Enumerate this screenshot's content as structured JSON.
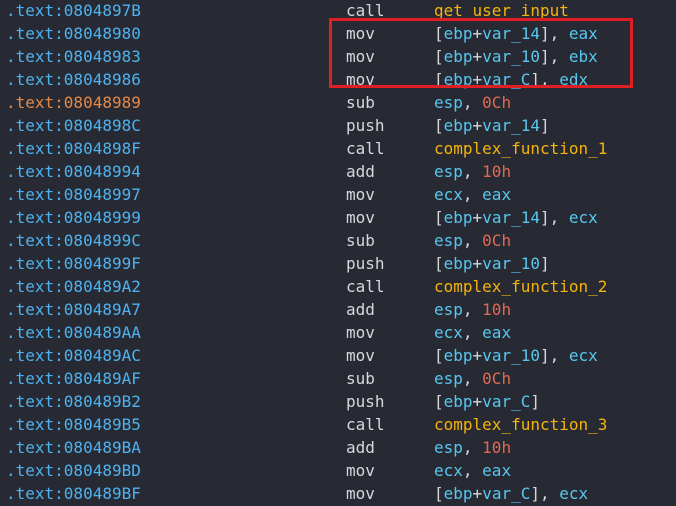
{
  "rows": [
    {
      "addr": ".text:0804897B",
      "mnemonic": "call",
      "tokens": [
        {
          "t": "fn",
          "v": "get_user_input"
        }
      ]
    },
    {
      "addr": ".text:08048980",
      "mnemonic": "mov",
      "tokens": [
        {
          "t": "punc",
          "v": "["
        },
        {
          "t": "reg",
          "v": "ebp"
        },
        {
          "t": "punc",
          "v": "+"
        },
        {
          "t": "reg",
          "v": "var_14"
        },
        {
          "t": "punc",
          "v": "], "
        },
        {
          "t": "reg",
          "v": "eax"
        }
      ]
    },
    {
      "addr": ".text:08048983",
      "mnemonic": "mov",
      "tokens": [
        {
          "t": "punc",
          "v": "["
        },
        {
          "t": "reg",
          "v": "ebp"
        },
        {
          "t": "punc",
          "v": "+"
        },
        {
          "t": "reg",
          "v": "var_10"
        },
        {
          "t": "punc",
          "v": "], "
        },
        {
          "t": "reg",
          "v": "ebx"
        }
      ]
    },
    {
      "addr": ".text:08048986",
      "mnemonic": "mov",
      "tokens": [
        {
          "t": "punc",
          "v": "["
        },
        {
          "t": "reg",
          "v": "ebp"
        },
        {
          "t": "punc",
          "v": "+"
        },
        {
          "t": "reg",
          "v": "var_C"
        },
        {
          "t": "punc",
          "v": "], "
        },
        {
          "t": "reg",
          "v": "edx"
        }
      ]
    },
    {
      "addr": ".text:08048989",
      "mnemonic": "sub",
      "current": true,
      "tokens": [
        {
          "t": "reg",
          "v": "esp"
        },
        {
          "t": "punc",
          "v": ", "
        },
        {
          "t": "num",
          "v": "0Ch"
        }
      ]
    },
    {
      "addr": ".text:0804898C",
      "mnemonic": "push",
      "tokens": [
        {
          "t": "punc",
          "v": "["
        },
        {
          "t": "reg",
          "v": "ebp"
        },
        {
          "t": "punc",
          "v": "+"
        },
        {
          "t": "reg",
          "v": "var_14"
        },
        {
          "t": "punc",
          "v": "]"
        }
      ]
    },
    {
      "addr": ".text:0804898F",
      "mnemonic": "call",
      "tokens": [
        {
          "t": "fn",
          "v": "complex_function_1"
        }
      ]
    },
    {
      "addr": ".text:08048994",
      "mnemonic": "add",
      "tokens": [
        {
          "t": "reg",
          "v": "esp"
        },
        {
          "t": "punc",
          "v": ", "
        },
        {
          "t": "num",
          "v": "10h"
        }
      ]
    },
    {
      "addr": ".text:08048997",
      "mnemonic": "mov",
      "tokens": [
        {
          "t": "reg",
          "v": "ecx"
        },
        {
          "t": "punc",
          "v": ", "
        },
        {
          "t": "reg",
          "v": "eax"
        }
      ]
    },
    {
      "addr": ".text:08048999",
      "mnemonic": "mov",
      "tokens": [
        {
          "t": "punc",
          "v": "["
        },
        {
          "t": "reg",
          "v": "ebp"
        },
        {
          "t": "punc",
          "v": "+"
        },
        {
          "t": "reg",
          "v": "var_14"
        },
        {
          "t": "punc",
          "v": "], "
        },
        {
          "t": "reg",
          "v": "ecx"
        }
      ]
    },
    {
      "addr": ".text:0804899C",
      "mnemonic": "sub",
      "tokens": [
        {
          "t": "reg",
          "v": "esp"
        },
        {
          "t": "punc",
          "v": ", "
        },
        {
          "t": "num",
          "v": "0Ch"
        }
      ]
    },
    {
      "addr": ".text:0804899F",
      "mnemonic": "push",
      "tokens": [
        {
          "t": "punc",
          "v": "["
        },
        {
          "t": "reg",
          "v": "ebp"
        },
        {
          "t": "punc",
          "v": "+"
        },
        {
          "t": "reg",
          "v": "var_10"
        },
        {
          "t": "punc",
          "v": "]"
        }
      ]
    },
    {
      "addr": ".text:080489A2",
      "mnemonic": "call",
      "tokens": [
        {
          "t": "fn",
          "v": "complex_function_2"
        }
      ]
    },
    {
      "addr": ".text:080489A7",
      "mnemonic": "add",
      "tokens": [
        {
          "t": "reg",
          "v": "esp"
        },
        {
          "t": "punc",
          "v": ", "
        },
        {
          "t": "num",
          "v": "10h"
        }
      ]
    },
    {
      "addr": ".text:080489AA",
      "mnemonic": "mov",
      "tokens": [
        {
          "t": "reg",
          "v": "ecx"
        },
        {
          "t": "punc",
          "v": ", "
        },
        {
          "t": "reg",
          "v": "eax"
        }
      ]
    },
    {
      "addr": ".text:080489AC",
      "mnemonic": "mov",
      "tokens": [
        {
          "t": "punc",
          "v": "["
        },
        {
          "t": "reg",
          "v": "ebp"
        },
        {
          "t": "punc",
          "v": "+"
        },
        {
          "t": "reg",
          "v": "var_10"
        },
        {
          "t": "punc",
          "v": "], "
        },
        {
          "t": "reg",
          "v": "ecx"
        }
      ]
    },
    {
      "addr": ".text:080489AF",
      "mnemonic": "sub",
      "tokens": [
        {
          "t": "reg",
          "v": "esp"
        },
        {
          "t": "punc",
          "v": ", "
        },
        {
          "t": "num",
          "v": "0Ch"
        }
      ]
    },
    {
      "addr": ".text:080489B2",
      "mnemonic": "push",
      "tokens": [
        {
          "t": "punc",
          "v": "["
        },
        {
          "t": "reg",
          "v": "ebp"
        },
        {
          "t": "punc",
          "v": "+"
        },
        {
          "t": "reg",
          "v": "var_C"
        },
        {
          "t": "punc",
          "v": "]"
        }
      ]
    },
    {
      "addr": ".text:080489B5",
      "mnemonic": "call",
      "tokens": [
        {
          "t": "fn",
          "v": "complex_function_3"
        }
      ]
    },
    {
      "addr": ".text:080489BA",
      "mnemonic": "add",
      "tokens": [
        {
          "t": "reg",
          "v": "esp"
        },
        {
          "t": "punc",
          "v": ", "
        },
        {
          "t": "num",
          "v": "10h"
        }
      ]
    },
    {
      "addr": ".text:080489BD",
      "mnemonic": "mov",
      "tokens": [
        {
          "t": "reg",
          "v": "ecx"
        },
        {
          "t": "punc",
          "v": ", "
        },
        {
          "t": "reg",
          "v": "eax"
        }
      ]
    },
    {
      "addr": ".text:080489BF",
      "mnemonic": "mov",
      "tokens": [
        {
          "t": "punc",
          "v": "["
        },
        {
          "t": "reg",
          "v": "ebp"
        },
        {
          "t": "punc",
          "v": "+"
        },
        {
          "t": "reg",
          "v": "var_C"
        },
        {
          "t": "punc",
          "v": "], "
        },
        {
          "t": "reg",
          "v": "ecx"
        }
      ]
    }
  ],
  "colors": {
    "background": "#272a33",
    "address": "#4fb2f0",
    "current_address": "#e5894a",
    "register": "#58c7f0",
    "function": "#f6b40b",
    "number": "#e06a55",
    "highlight_box": "#e01f25"
  }
}
